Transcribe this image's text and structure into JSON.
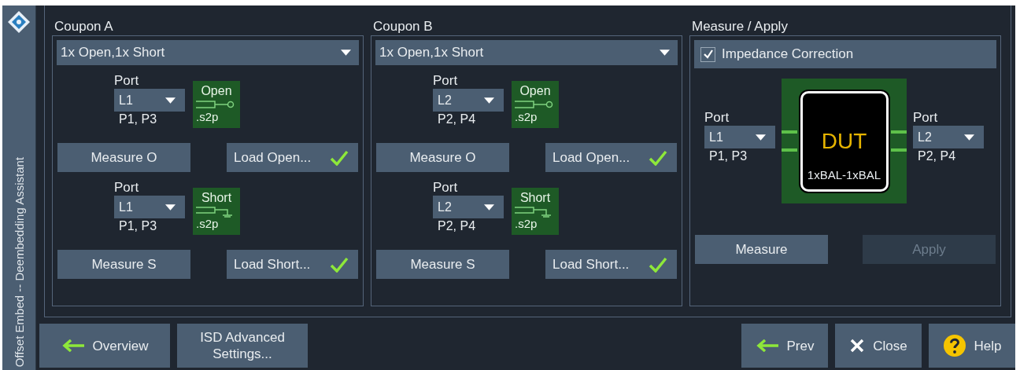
{
  "side_title": "Offset Embed -- Deembedding Assistant",
  "coupons": [
    {
      "title": "Coupon A",
      "mode": "1x Open,1x Short",
      "sections": [
        {
          "kind": "open",
          "port_label": "Port",
          "port": "L1",
          "pins": "P1, P3",
          "icon_title": "Open",
          "icon_ext": ".s2p",
          "measure_button": "Measure O",
          "load_button": "Load Open...",
          "loaded": true
        },
        {
          "kind": "short",
          "port_label": "Port",
          "port": "L1",
          "pins": "P1, P3",
          "icon_title": "Short",
          "icon_ext": ".s2p",
          "measure_button": "Measure S",
          "load_button": "Load Short...",
          "loaded": true
        }
      ]
    },
    {
      "title": "Coupon B",
      "mode": "1x Open,1x Short",
      "sections": [
        {
          "kind": "open",
          "port_label": "Port",
          "port": "L2",
          "pins": "P2, P4",
          "icon_title": "Open",
          "icon_ext": ".s2p",
          "measure_button": "Measure O",
          "load_button": "Load Open...",
          "loaded": true
        },
        {
          "kind": "short",
          "port_label": "Port",
          "port": "L2",
          "pins": "P2, P4",
          "icon_title": "Short",
          "icon_ext": ".s2p",
          "measure_button": "Measure S",
          "load_button": "Load Short...",
          "loaded": true
        }
      ]
    }
  ],
  "measure_apply": {
    "title": "Measure / Apply",
    "impedance_correction": {
      "label": "Impedance Correction",
      "checked": true
    },
    "ports": [
      {
        "label": "Port",
        "value": "L1",
        "pins": "P1, P3"
      },
      {
        "label": "Port",
        "value": "L2",
        "pins": "P2, P4"
      }
    ],
    "dut": {
      "title": "DUT",
      "subtitle": "1xBAL-1xBAL"
    },
    "buttons": [
      {
        "label": "Measure",
        "disabled": false
      },
      {
        "label": "Apply",
        "disabled": true
      }
    ]
  },
  "bottom_left": [
    {
      "label": "Overview",
      "kind": "back"
    },
    {
      "label": "ISD Advanced Settings...",
      "kind": "plain"
    }
  ],
  "bottom_right": [
    {
      "label": "Prev",
      "kind": "back"
    },
    {
      "label": "Close",
      "kind": "close"
    },
    {
      "label": "Help",
      "kind": "help"
    }
  ]
}
